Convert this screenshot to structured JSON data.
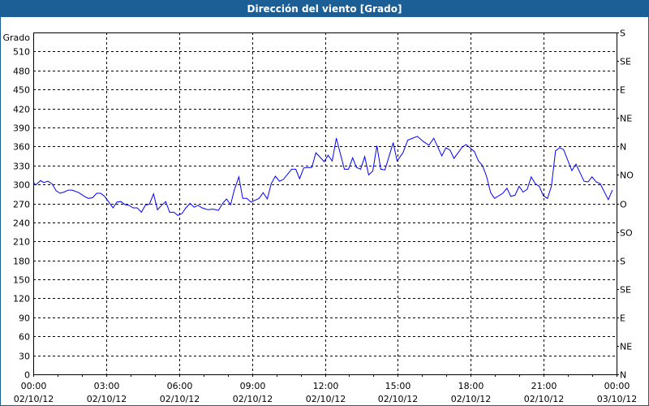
{
  "window": {
    "title": "Dirección del viento [Grado]"
  },
  "chart_data": {
    "type": "line",
    "title": "Dirección del viento [Grado]",
    "ylabel": "Grado",
    "xlabel": "",
    "ylim": [
      0,
      540
    ],
    "xlim_hours": [
      0,
      24
    ],
    "grid": true,
    "yticks": [
      0,
      30,
      60,
      90,
      120,
      150,
      180,
      210,
      240,
      270,
      300,
      330,
      360,
      390,
      420,
      450,
      480,
      510
    ],
    "right_axis": [
      {
        "value": 540,
        "label": "S"
      },
      {
        "value": 495,
        "label": "SE"
      },
      {
        "value": 450,
        "label": "E"
      },
      {
        "value": 405,
        "label": "NE"
      },
      {
        "value": 360,
        "label": "N"
      },
      {
        "value": 315,
        "label": "NO"
      },
      {
        "value": 270,
        "label": "O"
      },
      {
        "value": 225,
        "label": "SO"
      },
      {
        "value": 180,
        "label": "S"
      },
      {
        "value": 135,
        "label": "SE"
      },
      {
        "value": 90,
        "label": "E"
      },
      {
        "value": 45,
        "label": "NE"
      },
      {
        "value": 0,
        "label": "N"
      }
    ],
    "xticks": [
      {
        "hour": 0,
        "time": "00:00",
        "date": "02/10/12"
      },
      {
        "hour": 3,
        "time": "03:00",
        "date": "02/10/12"
      },
      {
        "hour": 6,
        "time": "06:00",
        "date": "02/10/12"
      },
      {
        "hour": 9,
        "time": "09:00",
        "date": "02/10/12"
      },
      {
        "hour": 12,
        "time": "12:00",
        "date": "02/10/12"
      },
      {
        "hour": 15,
        "time": "15:00",
        "date": "02/10/12"
      },
      {
        "hour": 18,
        "time": "18:00",
        "date": "02/10/12"
      },
      {
        "hour": 21,
        "time": "21:00",
        "date": "02/10/12"
      },
      {
        "hour": 24,
        "time": "00:00",
        "date": "03/10/12"
      }
    ],
    "series": [
      {
        "name": "Dirección del viento",
        "color": "#0000ff",
        "x": [
          0,
          0.1,
          0.3,
          0.43,
          0.6,
          0.77,
          0.94,
          1.1,
          1.27,
          1.44,
          1.6,
          1.87,
          2.11,
          2.27,
          2.44,
          2.61,
          2.77,
          2.94,
          3.11,
          3.28,
          3.44,
          3.61,
          3.78,
          3.94,
          4.11,
          4.28,
          4.45,
          4.61,
          4.78,
          4.95,
          5.11,
          5.28,
          5.45,
          5.61,
          5.78,
          5.95,
          6.12,
          6.28,
          6.45,
          6.62,
          6.78,
          6.95,
          7.19,
          7.39,
          7.62,
          7.79,
          7.95,
          8.12,
          8.26,
          8.46,
          8.62,
          8.79,
          8.96,
          9.29,
          9.46,
          9.63,
          9.79,
          9.96,
          10.13,
          10.29,
          10.63,
          10.8,
          10.96,
          11.13,
          11.46,
          11.63,
          11.97,
          12.13,
          12.3,
          12.47,
          12.8,
          12.97,
          13.14,
          13.3,
          13.47,
          13.64,
          13.8,
          13.97,
          14.14,
          14.3,
          14.47,
          14.81,
          14.97,
          15.21,
          15.41,
          15.81,
          16.04,
          16.28,
          16.48,
          16.81,
          16.98,
          17.15,
          17.31,
          17.65,
          17.81,
          18.15,
          18.32,
          18.48,
          18.65,
          18.82,
          18.98,
          19.32,
          19.49,
          19.65,
          19.82,
          19.99,
          20.15,
          20.32,
          20.49,
          20.66,
          20.82,
          20.99,
          21.16,
          21.32,
          21.49,
          21.66,
          21.82,
          22.16,
          22.33,
          22.49,
          22.66,
          22.83,
          22.99,
          23.16,
          23.33,
          23.66,
          23.83
        ],
        "y": [
          304,
          299,
          306,
          303,
          305,
          301,
          290,
          286,
          288,
          291,
          291,
          287,
          281,
          278,
          279,
          286,
          286,
          281,
          272,
          263,
          272,
          273,
          268,
          267,
          263,
          263,
          256,
          267,
          269,
          285,
          260,
          267,
          273,
          256,
          256,
          251,
          254,
          263,
          270,
          264,
          267,
          263,
          260,
          261,
          259,
          270,
          277,
          268,
          290,
          312,
          278,
          278,
          272,
          278,
          287,
          277,
          301,
          313,
          305,
          308,
          324,
          324,
          309,
          326,
          327,
          350,
          336,
          346,
          337,
          373,
          324,
          324,
          342,
          327,
          324,
          344,
          315,
          321,
          361,
          324,
          323,
          366,
          337,
          350,
          370,
          376,
          368,
          362,
          373,
          345,
          358,
          354,
          341,
          359,
          363,
          352,
          337,
          330,
          313,
          287,
          278,
          286,
          294,
          281,
          283,
          297,
          288,
          292,
          312,
          301,
          297,
          282,
          278,
          297,
          353,
          358,
          355,
          322,
          332,
          319,
          305,
          304,
          312,
          304,
          301,
          276,
          291
        ]
      }
    ]
  }
}
